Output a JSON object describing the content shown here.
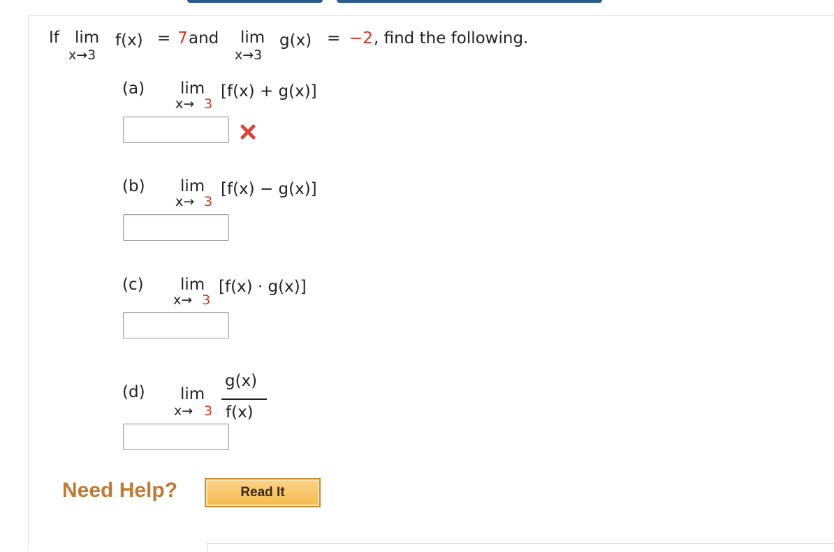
{
  "question": {
    "prefix": "If",
    "lim": "lim",
    "sub": "x→3",
    "fx": "f(x)",
    "eq1": "= ",
    "val1": "7",
    "and": " and",
    "gx": "g(x)",
    "eq2": "= ",
    "val2": "−2",
    "suffix": ", find the following."
  },
  "parts": {
    "a": {
      "label": "(a)",
      "lim": "lim",
      "sub_x": "x→",
      "sub_n": "3",
      "expr": "[f(x) + g(x)]",
      "answer": ""
    },
    "b": {
      "label": "(b)",
      "lim": "lim",
      "sub_x": "x→",
      "sub_n": "3",
      "expr": "[f(x) − g(x)]",
      "answer": ""
    },
    "c": {
      "label": "(c)",
      "lim": "lim",
      "sub_x": "x→",
      "sub_n": "3",
      "expr": "[f(x) · g(x)]",
      "answer": ""
    },
    "d": {
      "label": "(d)",
      "lim": "lim",
      "sub_x": "x→",
      "sub_n": "3",
      "numerator": "g(x)",
      "denominator": "f(x)",
      "answer": ""
    }
  },
  "feedback": {
    "a": "x-mark-icon"
  },
  "help": {
    "label": "Need Help?",
    "button": "Read It"
  },
  "colors": {
    "accent_red": "#d8341f",
    "help_orange": "#c07a35",
    "button_fill": "#f4b84c"
  }
}
